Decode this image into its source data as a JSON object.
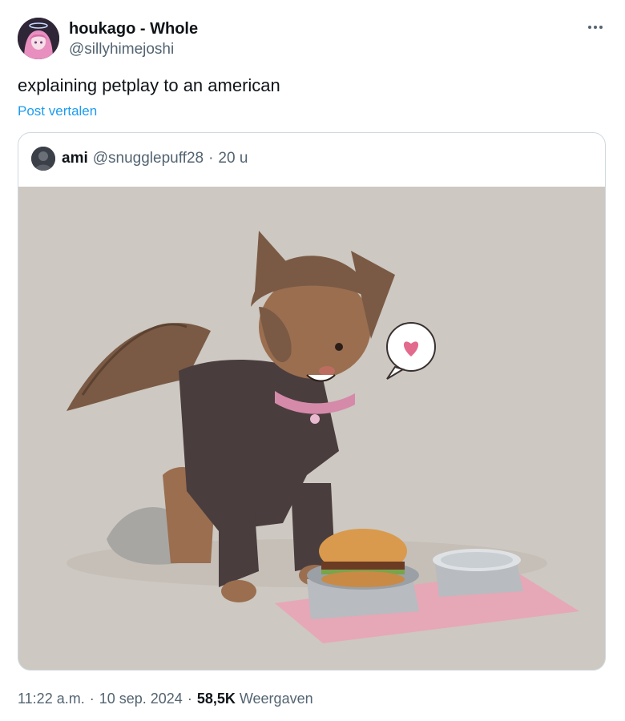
{
  "post": {
    "author": {
      "display_name": "houkago - Whole",
      "handle": "@sillyhimejoshi",
      "avatar": "anime-pink-hair-avatar"
    },
    "text": "explaining petplay to an american",
    "translate_label": "Post vertalen",
    "more_icon": "more-horizontal-icon"
  },
  "quote": {
    "author_name": "ami",
    "handle": "@snugglepuff28",
    "separator": "·",
    "time": "20 u",
    "avatar": "dark-avatar",
    "media": "illustration-dog-character-with-burger-bowl"
  },
  "meta": {
    "time": "11:22 a.m.",
    "date": "10 sep. 2024",
    "views_count": "58,5K",
    "views_label": "Weergaven",
    "separator": "·"
  },
  "colors": {
    "text": "#0f1419",
    "secondary": "#536471",
    "link": "#1d9bf0",
    "border": "#cfd9de",
    "media_bg": "#cdc8c1"
  }
}
